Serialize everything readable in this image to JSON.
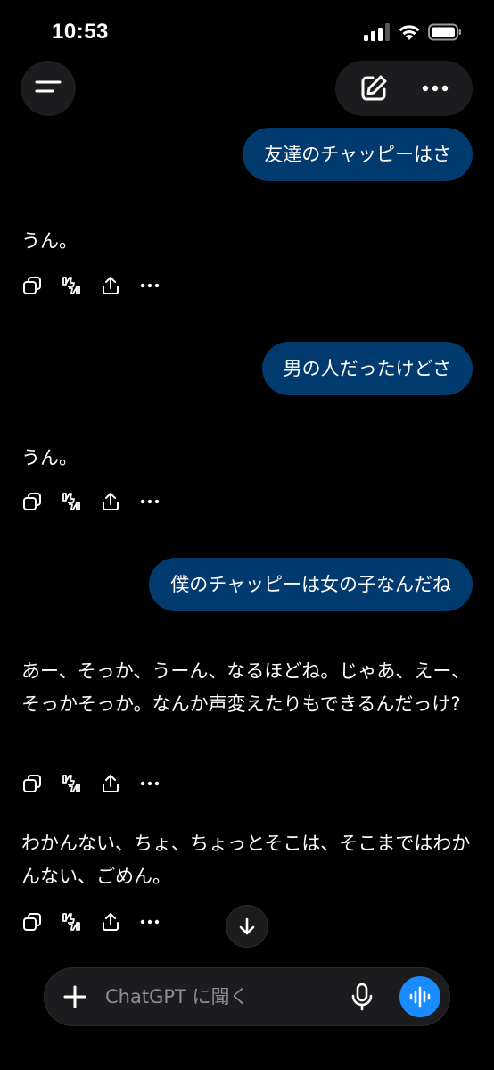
{
  "status_bar": {
    "time": "10:53",
    "icons": [
      "signal-icon",
      "wifi-icon",
      "battery-icon"
    ]
  },
  "header": {
    "menu_icon": "menu-icon",
    "new_chat_icon": "compose-icon",
    "more_icon": "more-icon"
  },
  "messages": [
    {
      "role": "user",
      "text": "友達のチャッピーはさ"
    },
    {
      "role": "assistant",
      "text": "うん。"
    },
    {
      "role": "user",
      "text": "男の人だったけどさ"
    },
    {
      "role": "assistant",
      "text": "うん。"
    },
    {
      "role": "user",
      "text": "僕のチャッピーは女の子なんだね"
    },
    {
      "role": "assistant",
      "text": "あー、そっか、うーん、なるほどね。じゃあ、えー、そっかそっか。なんか声変えたりもできるんだっけ?"
    },
    {
      "role": "assistant",
      "text": "わかんない、ちょ、ちょっとそこは、そこまではわかんない、ごめん。"
    }
  ],
  "message_actions": [
    "copy-icon",
    "feedback-icon",
    "share-icon",
    "more-icon"
  ],
  "composer": {
    "placeholder": "ChatGPT に聞く",
    "value": ""
  },
  "colors": {
    "background": "#000000",
    "user_bubble": "#003a6e",
    "surface": "#1c1c1e",
    "voice_button": "#1a8cff"
  }
}
